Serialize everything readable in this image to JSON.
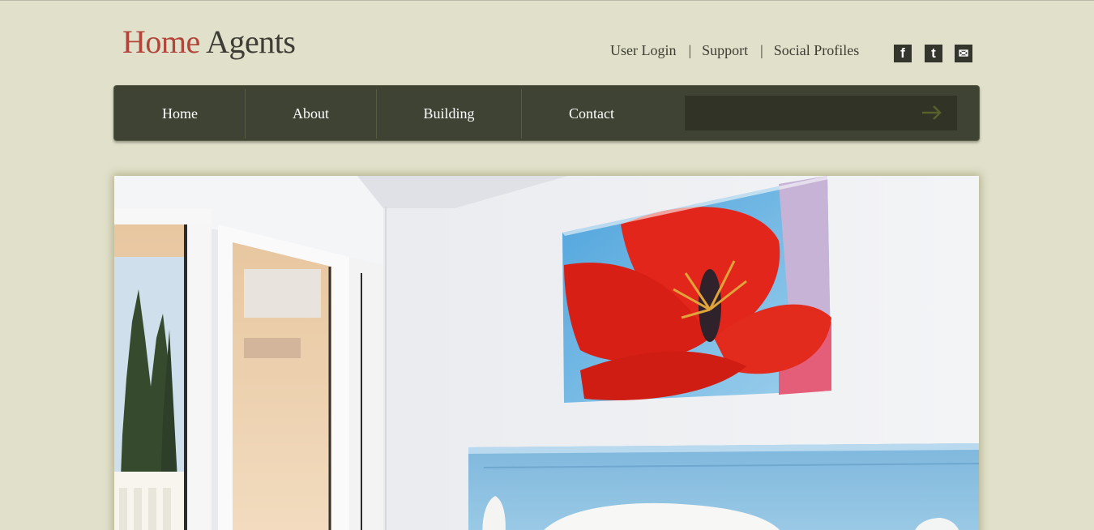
{
  "logo": {
    "home": "Home",
    "agents": "Agents"
  },
  "toplinks": {
    "user_login": "User Login",
    "separator": "|",
    "support": "Support",
    "social_profiles": "Social Profiles"
  },
  "social": [
    {
      "icon": "facebook-icon",
      "glyph": "f"
    },
    {
      "icon": "twitter-icon",
      "glyph": "t"
    },
    {
      "icon": "mail-icon",
      "glyph": "✉"
    }
  ],
  "nav": {
    "items": [
      "Home",
      "About",
      "Building",
      "Contact"
    ],
    "search_placeholder": ""
  },
  "colors": {
    "background": "#e1e1cb",
    "nav": "#3f4333",
    "logo_accent": "#b1453a"
  }
}
